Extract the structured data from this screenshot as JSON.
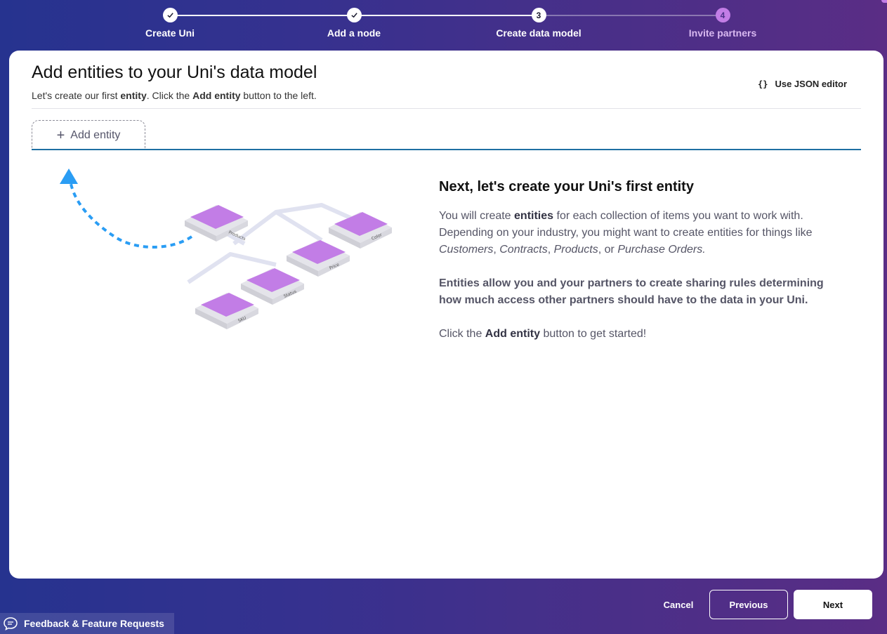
{
  "stepper": {
    "steps": [
      {
        "number": "1",
        "label": "Create Uni",
        "state": "done"
      },
      {
        "number": "2",
        "label": "Add a node",
        "state": "done"
      },
      {
        "number": "3",
        "label": "Create data model",
        "state": "current"
      },
      {
        "number": "4",
        "label": "Invite partners",
        "state": "future"
      }
    ]
  },
  "header": {
    "title": "Add entities to your Uni's data model",
    "subtitle_pre": "Let's create our first ",
    "subtitle_entity": "entity",
    "subtitle_mid": ". Click the ",
    "subtitle_btn": "Add entity",
    "subtitle_post": " button to the left.",
    "json_editor_icon": "{}",
    "json_editor_label": "Use JSON editor"
  },
  "tabs": {
    "add_entity_label": "Add entity",
    "add_entity_icon": "plus-icon"
  },
  "illustration": {
    "tiles": [
      "Products",
      "Color",
      "Price",
      "Status",
      "SKU"
    ]
  },
  "info": {
    "title": "Next, let's create your Uni's first entity",
    "p1_a": "You will create ",
    "p1_b": "entities",
    "p1_c": " for each collection of items you want to work with. Depending on your industry, you might want to create entities for things like ",
    "p1_customers": "Customers",
    "p1_sep1": ", ",
    "p1_contracts": "Contracts",
    "p1_sep2": ", ",
    "p1_products": "Products",
    "p1_sep3": ", or ",
    "p1_orders": "Purchase Orders.",
    "p2": "Entities allow you and your partners to create sharing rules determining how much access other partners should have to the data in your Uni.",
    "p3_a": "Click the ",
    "p3_b": "Add entity",
    "p3_c": " button to get started!"
  },
  "footer": {
    "cancel": "Cancel",
    "previous": "Previous",
    "next": "Next",
    "feedback": "Feedback & Feature Requests"
  },
  "colors": {
    "accent_blue": "#1e6fa3",
    "tile_purple": "#c27de6",
    "arrow_blue": "#2a9df4"
  }
}
